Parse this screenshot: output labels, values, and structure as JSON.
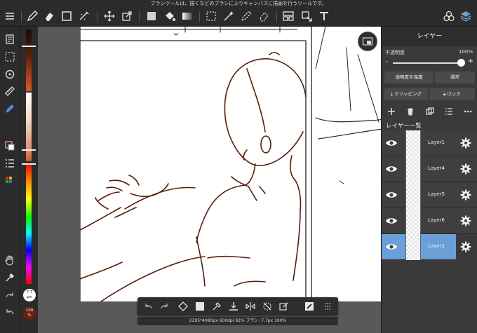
{
  "hint_text": "ブラシツールは、描くなどのブラシによりキャンバスに描画を行うツールです。",
  "toolbar": {
    "icons": [
      "menu-icon",
      "pen-icon",
      "eraser-icon",
      "rectangle-icon",
      "magic-lasso-icon",
      "move-icon",
      "transform-icon",
      "fill-square-icon",
      "bucket-icon",
      "gradient-icon",
      "select-rect-icon",
      "magic-wand-icon",
      "select-pen-icon",
      "select-eraser-icon",
      "panels-icon",
      "paste-icon",
      "text-icon",
      "materials-icon",
      "layers-icon"
    ]
  },
  "left_tools": {
    "brush_size": "7.7",
    "brush_size_unit": "px",
    "opacity": "100",
    "opacity_unit": "%"
  },
  "canvas": {
    "status": "2295*4080px 600dpi 92% ブラシ: 7.7px 100%"
  },
  "layer_panel": {
    "title": "レイヤー",
    "opacity_label": "不透明度",
    "opacity_value": "100%",
    "opacity_level": 1.0,
    "minus_label": "-",
    "plus_label": "+",
    "protect_transparency_label": "透明度を保護",
    "blend_mode_label": "通常",
    "clipping_label": "クリッピング",
    "lock_label": "ロック",
    "list_header": "レイヤー一覧",
    "layers": [
      {
        "name": "Layer1",
        "active": false
      },
      {
        "name": "Layer4",
        "active": false
      },
      {
        "name": "Layer5",
        "active": false
      },
      {
        "name": "Layer6",
        "active": false
      },
      {
        "name": "Layer2",
        "active": true
      }
    ]
  },
  "colors": {
    "accent": "#6a9fd8",
    "line_art": "#5a1d08"
  }
}
